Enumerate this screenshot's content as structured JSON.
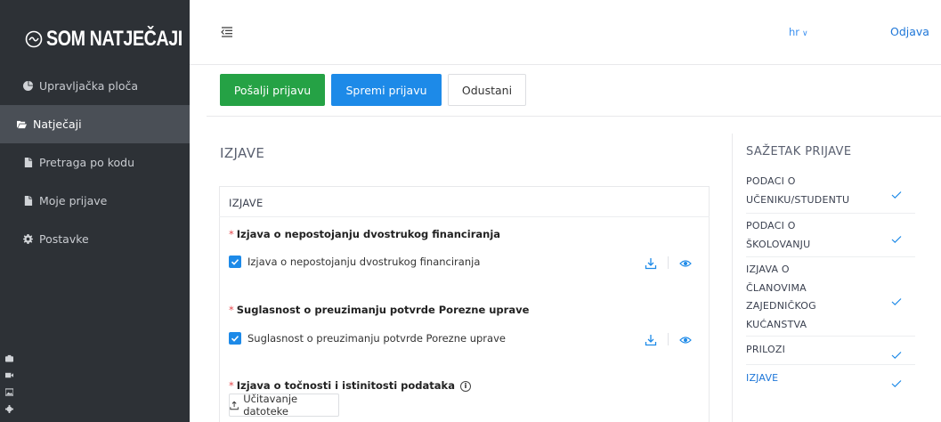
{
  "brand": {
    "title": "SOM NATJEČAJI"
  },
  "sidebar": {
    "items": [
      {
        "label": "Upravljačka ploča",
        "icon": "pie-chart-icon"
      },
      {
        "label": "Natječaji",
        "icon": "folder-open-icon",
        "active": true
      },
      {
        "label": "Pretraga po kodu",
        "icon": "file-icon"
      },
      {
        "label": "Moje prijave",
        "icon": "file-icon"
      },
      {
        "label": "Postavke",
        "icon": "gear-icon"
      }
    ]
  },
  "header": {
    "language": "hr",
    "logout": "Odjava"
  },
  "actions": {
    "send": "Pošalji prijavu",
    "save": "Spremi prijavu",
    "cancel": "Odustani"
  },
  "main": {
    "section_title": "IZJAVE",
    "card_title": "IZJAVE",
    "statements": [
      {
        "label": "Izjava o nepostojanju dvostrukog financiranja",
        "checkbox_label": "Izjava o nepostojanju dvostrukog financiranja",
        "checked": true
      },
      {
        "label": "Suglasnost o preuzimanju potvrde Porezne uprave",
        "checkbox_label": "Suglasnost o preuzimanju potvrde Porezne uprave",
        "checked": true
      },
      {
        "label": "Izjava o točnosti i istinitosti podataka",
        "upload_label": "Učitavanje datoteke"
      }
    ]
  },
  "summary": {
    "title": "SAŽETAK PRIJAVE",
    "items": [
      {
        "label": "PODACI O\nUČENIKU/STUDENTU",
        "done": true
      },
      {
        "label": "PODACI O\nŠKOLOVANJU",
        "done": true
      },
      {
        "label": "IZJAVA O\nČLANOVIMA\nZAJEDNIČKOG\nKUĆANSTVA",
        "done": true
      },
      {
        "label": "PRILOZI",
        "done": true
      },
      {
        "label": "IZJAVE",
        "done": true,
        "active": true
      }
    ]
  },
  "colors": {
    "sidebar_bg": "#2d3136",
    "sidebar_active": "#4a4f56",
    "send_button": "#25a245",
    "save_button": "#1d8ae8",
    "required": "#e5484d",
    "accent": "#1d76d8"
  }
}
